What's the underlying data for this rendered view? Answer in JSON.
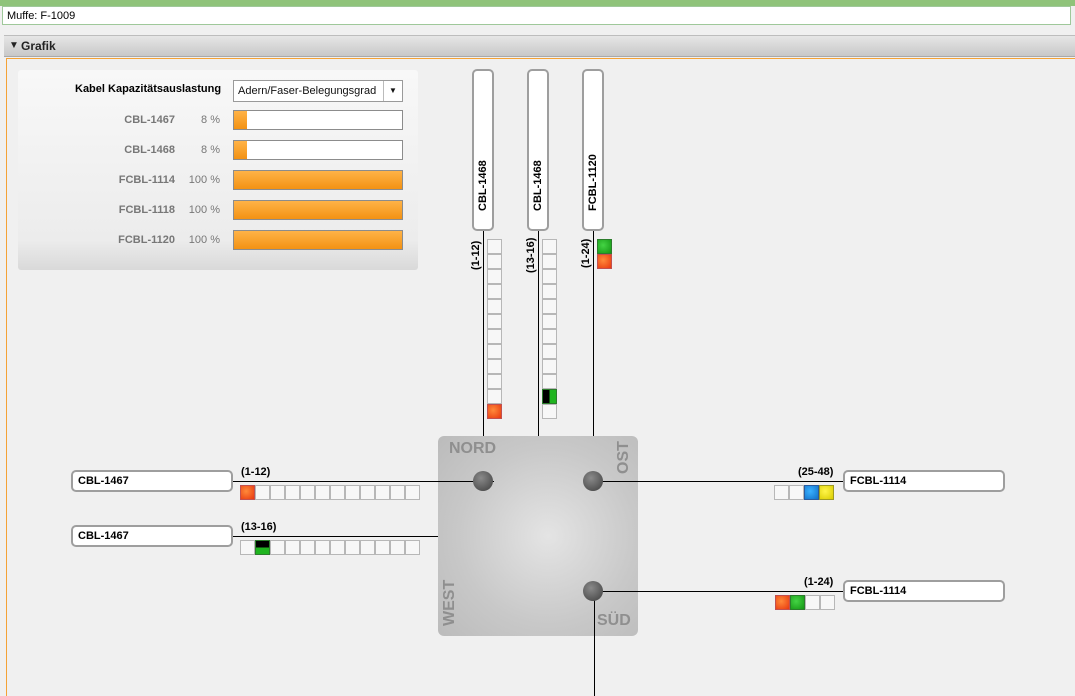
{
  "window": {
    "title": "Muffe: F-1009"
  },
  "section": {
    "title": "Grafik"
  },
  "capacity": {
    "label": "Kabel Kapazitätsauslastung",
    "mode_selected": "Adern/Faser-Belegungsgrad",
    "rows": [
      {
        "name": "CBL-1467",
        "pct_label": "8 %",
        "fraction": 0.08
      },
      {
        "name": "CBL-1468",
        "pct_label": "8 %",
        "fraction": 0.08
      },
      {
        "name": "FCBL-1114",
        "pct_label": "100 %",
        "fraction": 1.0
      },
      {
        "name": "FCBL-1118",
        "pct_label": "100 %",
        "fraction": 1.0
      },
      {
        "name": "FCBL-1120",
        "pct_label": "100 %",
        "fraction": 1.0
      }
    ]
  },
  "node": {
    "north": "NORD",
    "east": "OST",
    "south": "SÜD",
    "west": "WEST"
  },
  "cables": {
    "north1": {
      "name": "CBL-1468",
      "range": "(1-12)"
    },
    "north2": {
      "name": "CBL-1468",
      "range": "(13-16)"
    },
    "north3": {
      "name": "FCBL-1120",
      "range": "(1-24)"
    },
    "west1": {
      "name": "CBL-1467",
      "range": "(1-12)"
    },
    "west2": {
      "name": "CBL-1467",
      "range": "(13-16)"
    },
    "east1": {
      "name": "FCBL-1114",
      "range": "(25-48)"
    },
    "east2": {
      "name": "FCBL-1114",
      "range": "(1-24)"
    }
  },
  "colors": {
    "accent": "#f39213",
    "frame": "#f4a236",
    "fiber_red": "#e8380f",
    "fiber_green": "#149614",
    "fiber_blue": "#1170c8",
    "fiber_yellow": "#d9cc00"
  }
}
